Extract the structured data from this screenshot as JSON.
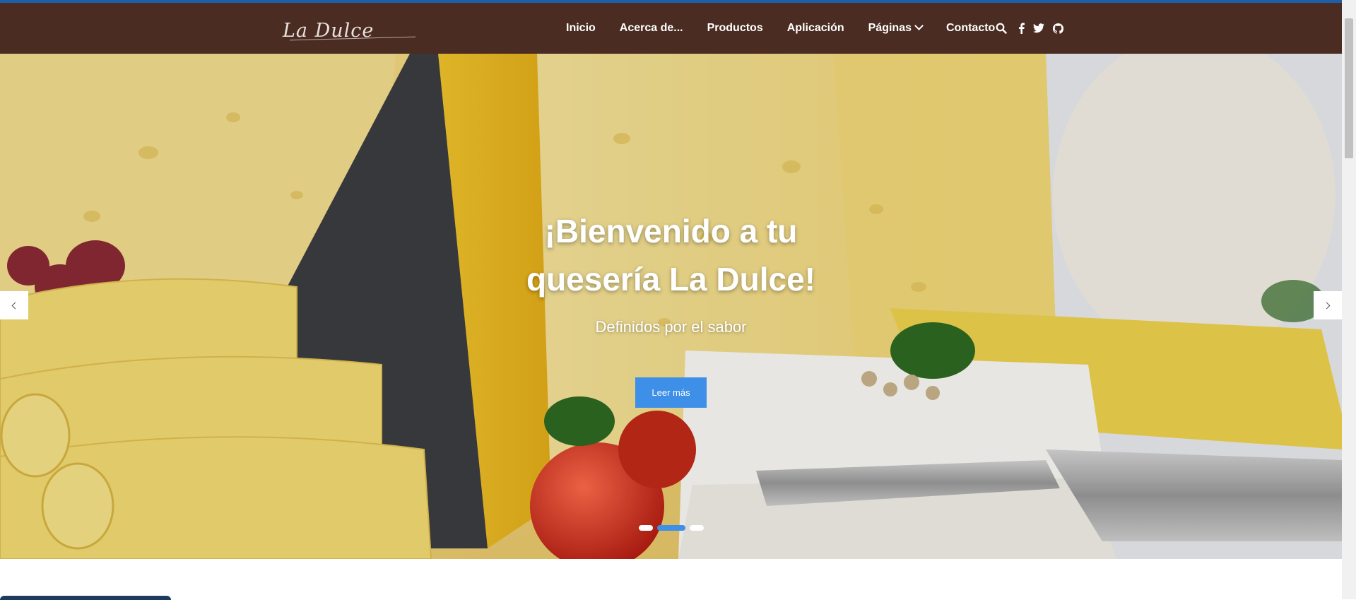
{
  "brand": {
    "logo_text": "La Dulce"
  },
  "nav": {
    "items": [
      {
        "label": "Inicio"
      },
      {
        "label": "Acerca de..."
      },
      {
        "label": "Productos"
      },
      {
        "label": "Aplicación"
      },
      {
        "label": "Páginas",
        "has_dropdown": true
      },
      {
        "label": "Contacto"
      }
    ],
    "icons": [
      "search-icon",
      "facebook-icon",
      "twitter-icon",
      "github-icon"
    ]
  },
  "hero": {
    "title_line1": "¡Bienvenido a tu",
    "title_line2": "quesería La Dulce!",
    "subtitle": "Definidos por el sabor",
    "button_label": "Leer más",
    "image_subject": "cheese assortment with tomatoes and parsley",
    "slides_count": 3,
    "active_slide": 2
  },
  "colors": {
    "navbar": "#4a2c22",
    "accent": "#3d8fe8",
    "top_border": "#1f5fa8"
  }
}
